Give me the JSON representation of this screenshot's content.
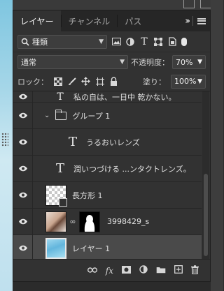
{
  "tabs": [
    {
      "label": "レイヤー"
    },
    {
      "label": "チャンネル"
    },
    {
      "label": "パス"
    }
  ],
  "filter": {
    "kind_label": "種類",
    "icons": [
      "image-filter-icon",
      "adjustment-filter-icon",
      "type-filter-icon",
      "shape-filter-icon",
      "smart-object-filter-icon"
    ]
  },
  "blend": {
    "mode": "通常",
    "opacity_label": "不透明度：",
    "opacity_value": "70%"
  },
  "lock": {
    "label": "ロック：",
    "fill_label": "塗り：",
    "fill_value": "100%"
  },
  "layers": [
    {
      "name": "私の自は、一日中 乾かない。",
      "type": "text",
      "partial": true
    },
    {
      "name": "グループ 1",
      "type": "group"
    },
    {
      "name": "うるおいレンズ",
      "type": "text",
      "indent": true
    },
    {
      "name": "潤いつづける ...ンタクトレンズ。",
      "type": "text"
    },
    {
      "name": "長方形 1",
      "type": "shape"
    },
    {
      "name": "3998429_s",
      "type": "masked-image"
    },
    {
      "name": "レイヤー 1",
      "type": "image",
      "selected": true
    }
  ],
  "footer": {
    "fx_label": "fx"
  }
}
